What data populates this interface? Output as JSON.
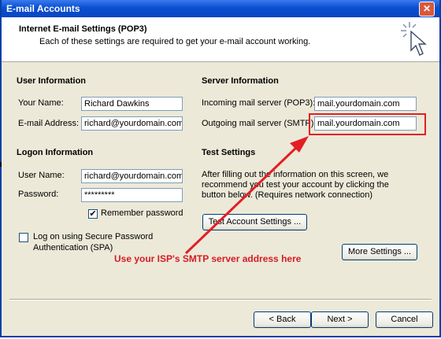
{
  "window": {
    "title": "E-mail Accounts",
    "close_glyph": "✕"
  },
  "header": {
    "title": "Internet E-mail Settings (POP3)",
    "subtitle": "Each of these settings are required to get your e-mail account working."
  },
  "user_info": {
    "heading": "User Information",
    "name_label": "Your Name:",
    "name_value": "Richard Dawkins",
    "email_label": "E-mail Address:",
    "email_value": "richard@yourdomain.com"
  },
  "logon_info": {
    "heading": "Logon Information",
    "username_label": "User Name:",
    "username_value": "richard@yourdomain.com",
    "password_label": "Password:",
    "password_value": "*********",
    "remember_label": "Remember password",
    "remember_checked": "✔",
    "spa_label_line1": "Log on using Secure Password",
    "spa_label_line2": "Authentication (SPA)"
  },
  "server_info": {
    "heading": "Server Information",
    "incoming_label": "Incoming mail server (POP3):",
    "incoming_value": "mail.yourdomain.com",
    "outgoing_label": "Outgoing mail server (SMTP):",
    "outgoing_value": "mail.yourdomain.com"
  },
  "test_settings": {
    "heading": "Test Settings",
    "description": "After filling out the information on this screen, we recommend you test your account by clicking the button below. (Requires network connection)",
    "test_button": "Test Account Settings ..."
  },
  "more_settings_button": "More Settings ...",
  "annotation": {
    "text": "Use your ISP's SMTP server address here",
    "color": "#d51c24"
  },
  "nav": {
    "back": "< Back",
    "next": "Next >",
    "cancel": "Cancel"
  },
  "colors": {
    "title_bar": "#0a4fd0",
    "dialog_bg": "#ece9d8",
    "highlight": "#e21f26"
  },
  "icons": [
    "close-icon",
    "wizard-cursor-icon",
    "checkmark-icon"
  ]
}
